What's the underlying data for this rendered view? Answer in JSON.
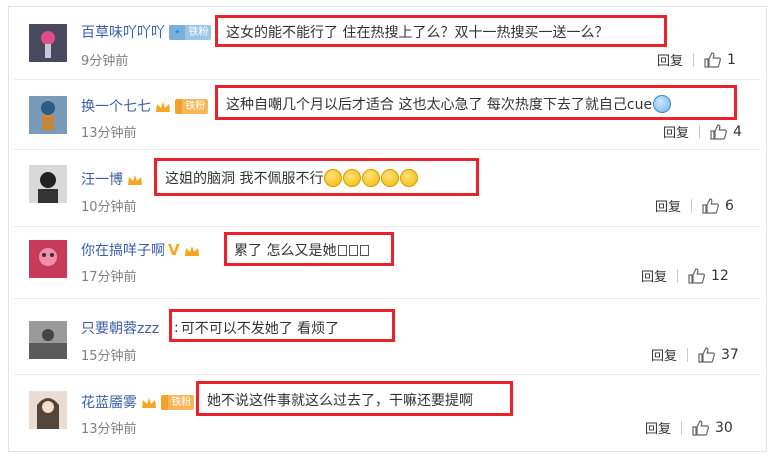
{
  "comments": [
    {
      "username": "百草味吖吖吖",
      "badges": {
        "fan_level": "🔹",
        "fan_label": "铁粉"
      },
      "text": "这女的能不能行了  住在热搜上了么？双十一热搜买一送一么？",
      "time": "9分钟前",
      "reply_label": "回复",
      "likes": "1"
    },
    {
      "username": "换一个七七",
      "badges": {
        "fan_level": "",
        "fan_label": "铁粉"
      },
      "text": "这种自嘲几个月以后才适合 这也太心急了 每次热度下去了就自己cue",
      "time": "13分钟前",
      "reply_label": "回复",
      "likes": "4"
    },
    {
      "username": "汪一博",
      "badges": {},
      "text": "这姐的脑洞  我不佩服不行",
      "time": "10分钟前",
      "reply_label": "回复",
      "likes": "6"
    },
    {
      "username": "你在搞咩子啊",
      "badges": {},
      "text": "累了 怎么又是她",
      "time": "17分钟前",
      "reply_label": "回复",
      "likes": "12"
    },
    {
      "username": "只要朝蓉zzz",
      "badges": {},
      "text": "可不可以不发她了  看烦了",
      "time": "15分钟前",
      "reply_label": "回复",
      "likes": "37"
    },
    {
      "username": "花蓝靥雾",
      "badges": {
        "fan_level": "",
        "fan_label": "铁粉"
      },
      "text": "她不说这件事就这么过去了，干嘛还要提啊",
      "time": "13分钟前",
      "reply_label": "回复",
      "likes": "30"
    }
  ],
  "icons": {
    "like": "thumbs-up-icon",
    "vip": "vip-crown-icon",
    "verified": "v-verified-icon"
  },
  "colors": {
    "username": "#3b5ea9",
    "highlight": "#e8232d",
    "time": "#808080",
    "fan_badge": "#7ab0d8"
  }
}
